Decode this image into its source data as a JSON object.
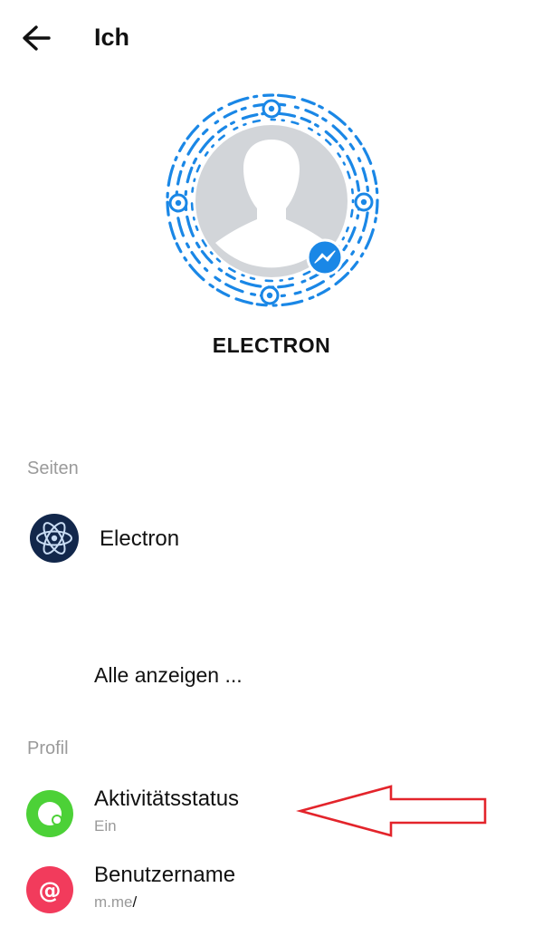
{
  "header": {
    "title": "Ich",
    "back_icon": "arrow-left-icon"
  },
  "profile": {
    "name": "ELECTRON",
    "code_color": "#1a87e6",
    "avatar_bg": "#d2d5d9",
    "badge_icon": "messenger-icon",
    "badge_color": "#1a87e6"
  },
  "sections": {
    "pages": {
      "label": "Seiten"
    },
    "profile": {
      "label": "Profil"
    }
  },
  "pages": [
    {
      "label": "Electron",
      "icon": "atom-logo-icon",
      "color": "#12274b"
    }
  ],
  "show_all": "Alle anzeigen ...",
  "profile_items": [
    {
      "title": "Aktivitätsstatus",
      "subtitle": "Ein",
      "icon": "activity-status-icon",
      "color": "#4cd137"
    },
    {
      "title": "Benutzername",
      "subtitle": "m.me",
      "suffix": "/",
      "icon": "at-sign-icon",
      "color": "#f23b5c"
    }
  ],
  "annotation": {
    "icon": "red-arrow-icon",
    "color": "#e3242b"
  }
}
